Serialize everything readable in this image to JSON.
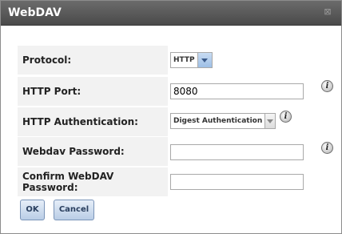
{
  "dialog": {
    "title": "WebDAV",
    "close_symbol": "⊠"
  },
  "form": {
    "protocol": {
      "label": "Protocol:",
      "selected": "HTTP"
    },
    "http_port": {
      "label": "HTTP Port:",
      "value": "8080",
      "info_symbol": "i"
    },
    "http_auth": {
      "label": "HTTP Authentication:",
      "selected": "Digest Authentication",
      "info_symbol": "i"
    },
    "webdav_password": {
      "label": "Webdav Password:",
      "value": "",
      "info_symbol": "i"
    },
    "confirm_password": {
      "label": "Confirm WebDAV Password:",
      "value": ""
    }
  },
  "buttons": {
    "ok_label": "OK",
    "cancel_label": "Cancel"
  },
  "colors": {
    "titlebar": "#555555",
    "label_bg": "#f2f2f2",
    "button_accent": "#b9cde6"
  },
  "icons": [
    "close-icon",
    "info-icon",
    "chevron-down-icon"
  ]
}
